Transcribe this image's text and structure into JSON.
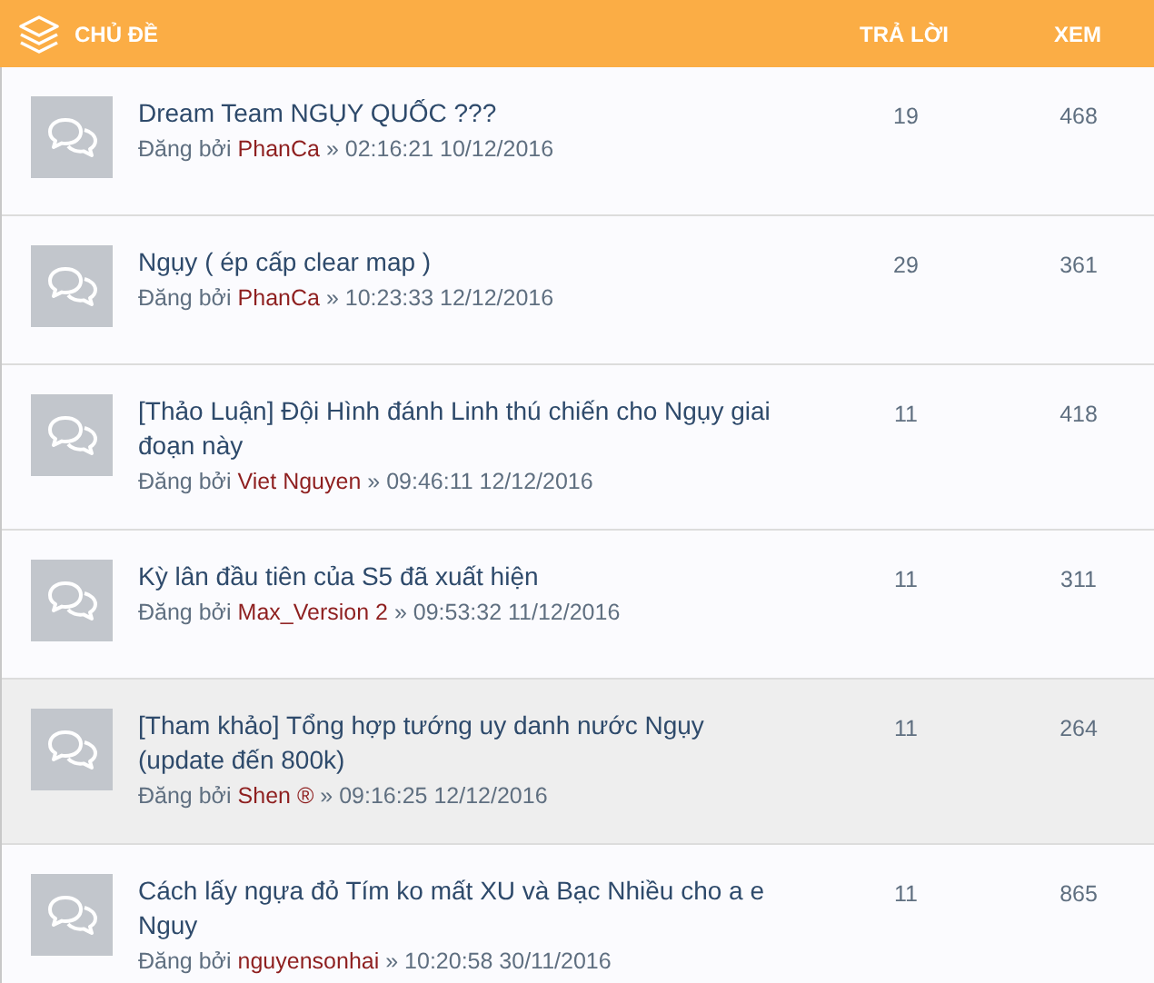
{
  "header": {
    "topic": "CHỦ ĐỀ",
    "replies": "TRẢ LỜI",
    "views": "XEM"
  },
  "topics": [
    {
      "title": "Dream Team NGỤY QUỐC ???",
      "posted_by": "Đăng bởi",
      "author": "PhanCa",
      "time": "» 02:16:21 10/12/2016",
      "replies": "19",
      "views": "468",
      "highlighted": false
    },
    {
      "title": "Ngụy ( ép cấp clear map )",
      "posted_by": "Đăng bởi",
      "author": "PhanCa",
      "time": "» 10:23:33 12/12/2016",
      "replies": "29",
      "views": "361",
      "highlighted": false
    },
    {
      "title": "[Thảo Luận] Đội Hình đánh Linh thú chiến cho Ngụy giai đoạn này",
      "posted_by": "Đăng bởi",
      "author": "Viet Nguyen",
      "time": "» 09:46:11 12/12/2016",
      "replies": "11",
      "views": "418",
      "highlighted": false
    },
    {
      "title": "Kỳ lân đầu tiên của S5 đã xuất hiện",
      "posted_by": "Đăng bởi",
      "author": "Max_Version 2",
      "time": "» 09:53:32 11/12/2016",
      "replies": "11",
      "views": "311",
      "highlighted": false
    },
    {
      "title": "[Tham khảo] Tổng hợp tướng uy danh nước Ngụy (update đến 800k)",
      "posted_by": "Đăng bởi",
      "author": "Shen ®",
      "time": "» 09:16:25 12/12/2016",
      "replies": "11",
      "views": "264",
      "highlighted": true
    },
    {
      "title": "Cách lấy ngựa đỏ Tím ko mất XU và Bạc Nhiều cho a e Nguy",
      "posted_by": "Đăng bởi",
      "author": "nguyensonhai",
      "time": "» 10:20:58 30/11/2016",
      "replies": "11",
      "views": "865",
      "highlighted": false
    }
  ]
}
